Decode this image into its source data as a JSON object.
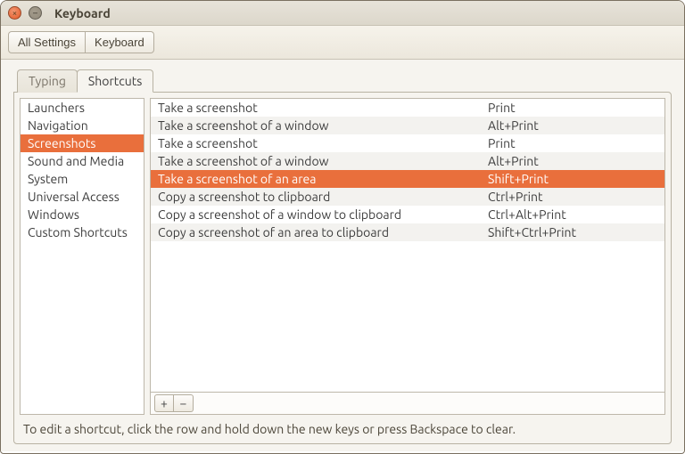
{
  "window": {
    "title": "Keyboard"
  },
  "toolbar": {
    "all_settings": "All Settings",
    "keyboard": "Keyboard"
  },
  "tabs": {
    "typing": "Typing",
    "shortcuts": "Shortcuts"
  },
  "categories": [
    {
      "label": "Launchers",
      "selected": false
    },
    {
      "label": "Navigation",
      "selected": false
    },
    {
      "label": "Screenshots",
      "selected": true
    },
    {
      "label": "Sound and Media",
      "selected": false
    },
    {
      "label": "System",
      "selected": false
    },
    {
      "label": "Universal Access",
      "selected": false
    },
    {
      "label": "Windows",
      "selected": false
    },
    {
      "label": "Custom Shortcuts",
      "selected": false
    }
  ],
  "shortcuts": [
    {
      "name": "Take a screenshot",
      "key": "Print",
      "selected": false
    },
    {
      "name": "Take a screenshot of a window",
      "key": "Alt+Print",
      "selected": false
    },
    {
      "name": "Take a screenshot",
      "key": "Print",
      "selected": false
    },
    {
      "name": "Take a screenshot of a window",
      "key": "Alt+Print",
      "selected": false
    },
    {
      "name": "Take a screenshot of an area",
      "key": "Shift+Print",
      "selected": true
    },
    {
      "name": "Copy a screenshot to clipboard",
      "key": "Ctrl+Print",
      "selected": false
    },
    {
      "name": "Copy a screenshot of a window to clipboard",
      "key": "Ctrl+Alt+Print",
      "selected": false
    },
    {
      "name": "Copy a screenshot of an area to clipboard",
      "key": "Shift+Ctrl+Print",
      "selected": false
    }
  ],
  "buttons": {
    "add": "+",
    "remove": "−"
  },
  "hint": "To edit a shortcut, click the row and hold down the new keys or press Backspace to clear."
}
